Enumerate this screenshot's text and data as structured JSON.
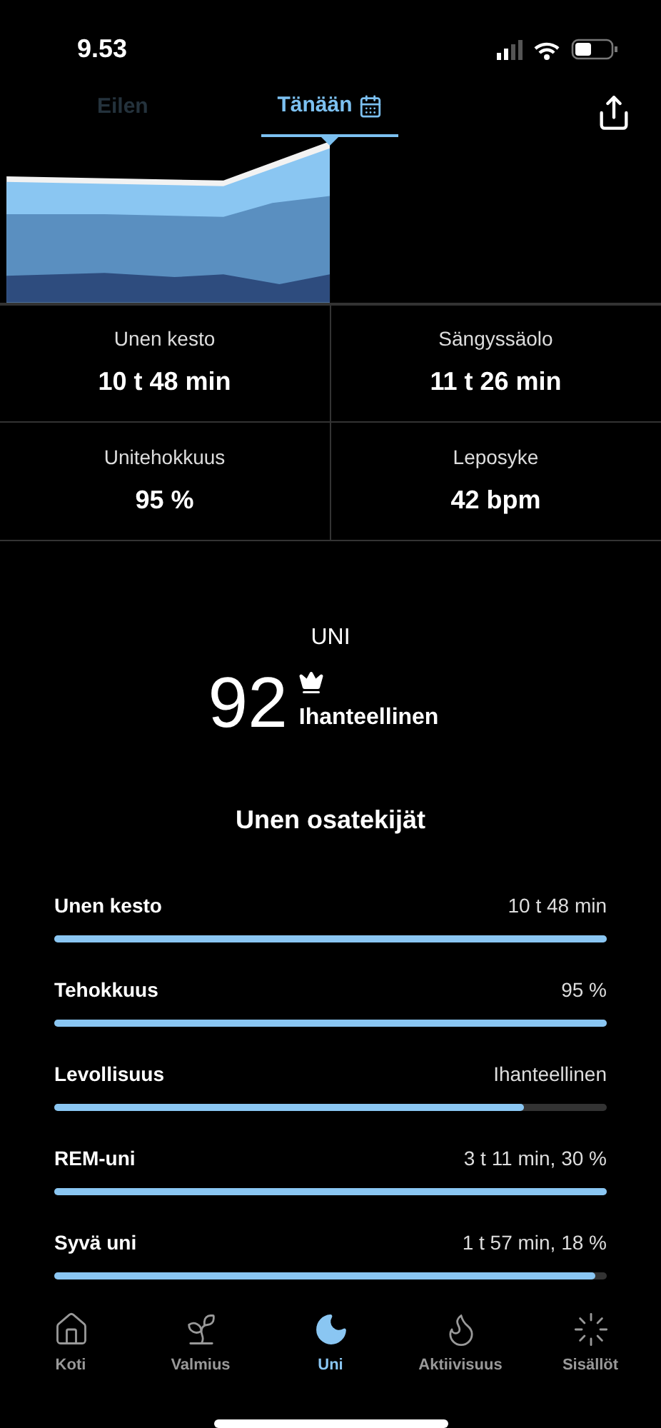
{
  "status_bar": {
    "time": "9.53"
  },
  "tabs": [
    {
      "label": "Eilen",
      "selected": false
    },
    {
      "label": "Tänään",
      "selected": true
    }
  ],
  "stats": [
    {
      "label": "Unen kesto",
      "value": "10 t 48 min"
    },
    {
      "label": "Sängyssäolo",
      "value": "11 t 26 min"
    },
    {
      "label": "Unitehokkuus",
      "value": "95 %"
    },
    {
      "label": "Leposyke",
      "value": "42 bpm"
    }
  ],
  "score": {
    "title": "UNI",
    "value": "92",
    "rating": "Ihanteellinen"
  },
  "contributors": {
    "title": "Unen osatekijät",
    "items": [
      {
        "label": "Unen kesto",
        "reading": "10 t 48 min",
        "level": 1
      },
      {
        "label": "Tehokkuus",
        "reading": "95 %",
        "level": 1
      },
      {
        "label": "Levollisuus",
        "reading": "Ihanteellinen",
        "level": 0.85
      },
      {
        "label": "REM-uni",
        "reading": "3 t 11 min, 30 %",
        "level": 1
      },
      {
        "label": "Syvä uni",
        "reading": "1 t 57 min, 18 %",
        "level": 0.98
      }
    ]
  },
  "nav": [
    {
      "label": "Koti",
      "selected": false
    },
    {
      "label": "Valmius",
      "selected": false
    },
    {
      "label": "Uni",
      "selected": true
    },
    {
      "label": "Aktiivisuus",
      "selected": false
    },
    {
      "label": "Sisällöt",
      "selected": false
    }
  ]
}
